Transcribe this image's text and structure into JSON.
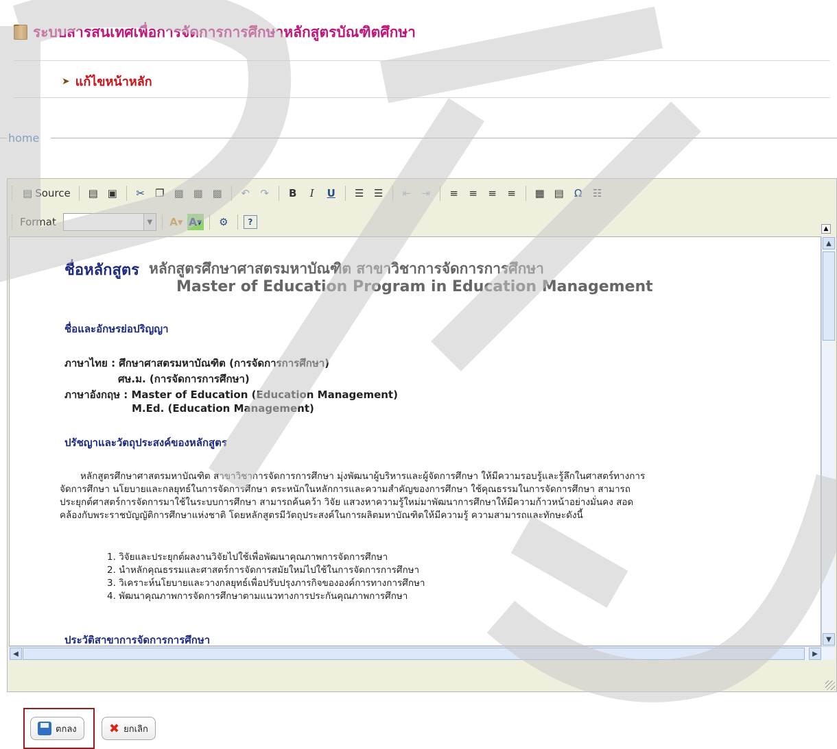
{
  "header": {
    "title": "ระบบสารสนเทศเพื่อการจัดการการศึกษาหลักสูตรบัณฑิตศึกษา"
  },
  "menu": {
    "edit_home": "แก้ไขหน้าหลัก"
  },
  "breadcrumb": {
    "home": "home"
  },
  "editor": {
    "source_label": "Source",
    "format_label": "Format",
    "format_value": "",
    "document": {
      "title_label": "ชื่อหลักสูตร",
      "title_th": "หลักสูตรศึกษาศาสตรมหาบัณฑิต สาขาวิชาการจัดการการศึกษา",
      "title_en": "Master of Education Program in Education Management",
      "section_degree": "ชื่อและอักษรย่อปริญญา",
      "degree_lines": [
        "ภาษาไทย :    ศึกษาศาสตรมหาบัณฑิต (การจัดการการศึกษา)",
        "ศษ.ม. (การจัดการการศึกษา)",
        "ภาษาอังกฤษ : Master of Education (Education Management)",
        "M.Ed. (Education Management)"
      ],
      "section_philosophy": "ปรัชญาและวัตถุประสงค์ของหลักสูตร",
      "philosophy_lines": [
        "หลักสูตรศึกษาศาสตรมหาบัณฑิต สาขาวิชาการจัดการการศึกษา มุ่งพัฒนาผู้บริหารและผู้จัดการศึกษา ให้มีความรอบรู้และรู้ลึกในศาสตร์ทางการ",
        "จัดการศึกษา นโยบายและกลยุทธ์ในการจัดการศึกษา ตระหนักในหลักการและความสำคัญของการศึกษา ใช้คุณธรรมในการจัดการศึกษา สามารถ",
        "ประยุกต์ศาสตร์การจัดการมาใช้ในระบบการศึกษา สามารถค้นคว้า วิจัย แสวงหาความรู้ใหม่มาพัฒนาการศึกษาให้มีความก้าวหน้าอย่างมั่นคง สอด",
        "คล้องกับพระราชบัญญัติการศึกษาแห่งชาติ โดยหลักสูตรมีวัตถุประสงค์ในการผลิตมหาบัณฑิตให้มีความรู้ ความสามารถและทักษะดังนี้"
      ],
      "objectives": [
        "1. วิจัยและประยุกต์ผลงานวิจัยไปใช้เพื่อพัฒนาคุณภาพการจัดการศึกษา",
        "2. นำหลักคุณธรรมและศาสตร์การจัดการสมัยใหม่ไปใช้ในการจัดการการศึกษา",
        "3. วิเคราะห์นโยบายและวางกลยุทธ์เพื่อปรับปรุงภารกิจขององค์การทางการศึกษา",
        "4. พัฒนาคุณภาพการจัดการศึกษาตามแนวทางการประกันคุณภาพการศึกษา"
      ],
      "section_history": "ประวัติสาขาการจัดการการศึกษา"
    }
  },
  "actions": {
    "ok": "ตกลง",
    "cancel": "ยกเลิก"
  },
  "colors": {
    "title": "#c0157a",
    "menu": "#c5141a",
    "heading": "#1e2a82",
    "watermark": "#c8c8c8"
  }
}
